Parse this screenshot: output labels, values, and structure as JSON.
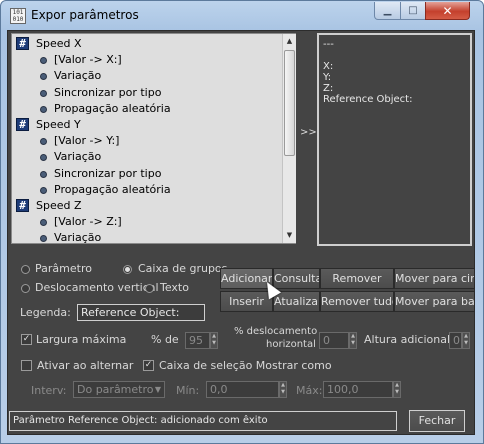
{
  "window": {
    "title": "Expor parâmetros",
    "app_icon_text": "1 0 1\n0 1 0"
  },
  "tree": {
    "items": [
      {
        "label": "Speed X",
        "type": "group"
      },
      {
        "label": "[Valor -> X:]",
        "type": "child"
      },
      {
        "label": "Variação",
        "type": "child"
      },
      {
        "label": "Sincronizar por tipo",
        "type": "child"
      },
      {
        "label": "Propagação aleatória",
        "type": "child"
      },
      {
        "label": "Speed Y",
        "type": "group"
      },
      {
        "label": "[Valor -> Y:]",
        "type": "child"
      },
      {
        "label": "Variação",
        "type": "child"
      },
      {
        "label": "Sincronizar por tipo",
        "type": "child"
      },
      {
        "label": "Propagação aleatória",
        "type": "child"
      },
      {
        "label": "Speed Z",
        "type": "group"
      },
      {
        "label": "[Valor -> Z:]",
        "type": "child"
      },
      {
        "label": "Variação",
        "type": "child"
      }
    ]
  },
  "arrows_label": ">>",
  "preview": {
    "lines": [
      "---",
      "",
      "X:",
      "Y:",
      "Z:",
      "Reference Object:"
    ]
  },
  "options": {
    "radio_parametro": "Parâmetro",
    "radio_caixa": "Caixa de grupos",
    "radio_deslocamento": "Deslocamento vertical",
    "radio_texto": "Texto",
    "legenda_label": "Legenda:",
    "legenda_value": "Reference Object:",
    "largura_label": "Largura máxima",
    "pct_de_label": "% de",
    "pct_de_value": "95",
    "desloc_horiz_label_1": "% deslocamento",
    "desloc_horiz_label_2": "horizontal",
    "desloc_horiz_value": "0",
    "altura_label": "Altura adicional:",
    "altura_value": "0",
    "ativar_label": "Ativar ao alternar",
    "caixa_selecao_label": "Caixa de seleção Mostrar como",
    "interv_label": "Interv:",
    "interv_value": "Do parâmetro",
    "min_label": "Mín:",
    "min_value": "0,0",
    "max_label": "Máx:",
    "max_value": "100,0"
  },
  "buttons": {
    "adicionar": "Adicionar",
    "consulta": "Consulta",
    "remover": "Remover",
    "mover_cima": "Mover para cima",
    "inserir": "Inserir",
    "atualizar": "Atualizar",
    "remover_tudo": "Remover tudo",
    "mover_baixo": "Mover para baixo",
    "fechar": "Fechar"
  },
  "status": {
    "text": "Parâmetro Reference Object: adicionado com êxito"
  },
  "colors": {
    "dialog_bg": "#444444",
    "list_bg": "#dedede",
    "group_icon": "#1e3c78"
  }
}
